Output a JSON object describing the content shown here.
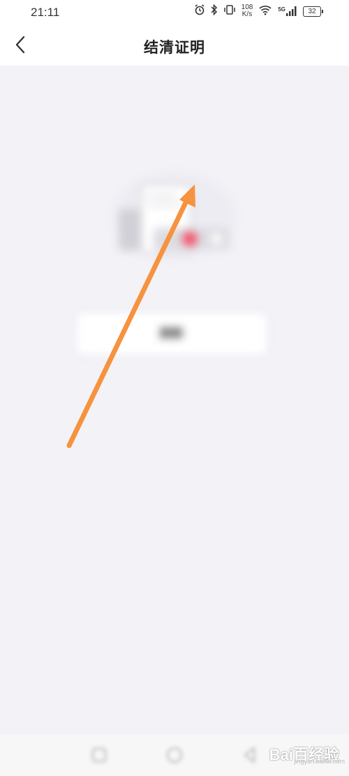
{
  "status_bar": {
    "time": "21:11",
    "network_speed_value": "108",
    "network_speed_unit": "K/s",
    "network_type": "5G",
    "battery_level": "32"
  },
  "nav": {
    "title": "结清证明"
  },
  "content": {
    "empty_message": "",
    "refresh_label": "刷新"
  },
  "watermark": {
    "brand": "Bai百经验",
    "url": "jingyan.baidu.com"
  },
  "colors": {
    "accent_arrow": "#f7923e",
    "background": "#f2f2f7",
    "nav_background": "#ffffff"
  }
}
